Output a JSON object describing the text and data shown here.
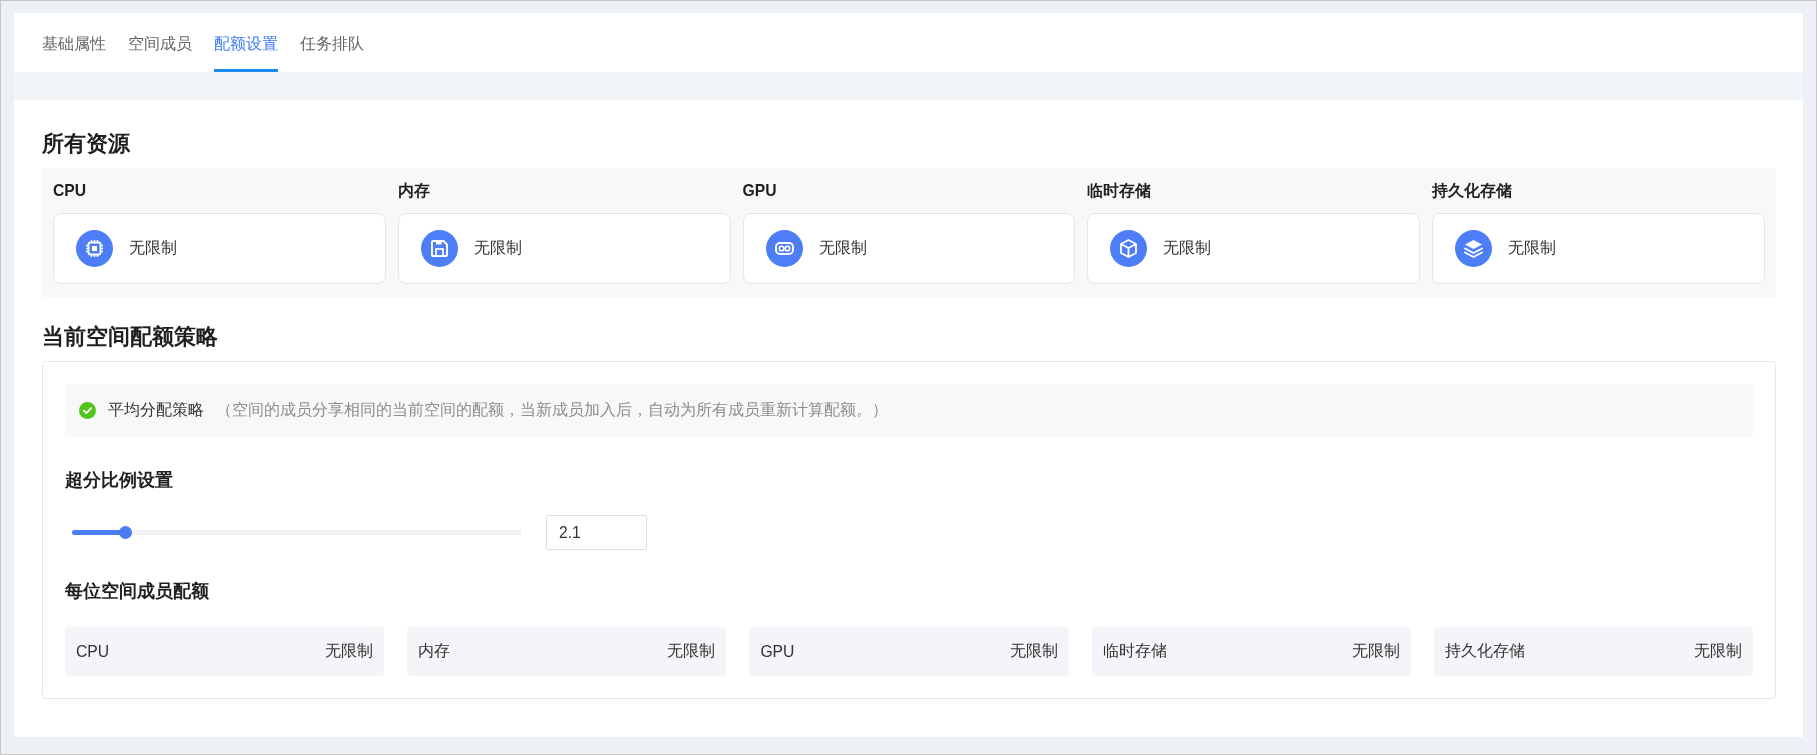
{
  "tabs": [
    {
      "label": "基础属性",
      "selected": false
    },
    {
      "label": "空间成员",
      "selected": false
    },
    {
      "label": "配额设置",
      "selected": true
    },
    {
      "label": "任务排队",
      "selected": false
    }
  ],
  "all_resources": {
    "title": "所有资源",
    "items": [
      {
        "label": "CPU",
        "value": "无限制"
      },
      {
        "label": "内存",
        "value": "无限制"
      },
      {
        "label": "GPU",
        "value": "无限制"
      },
      {
        "label": "临时存储",
        "value": "无限制"
      },
      {
        "label": "持久化存储",
        "value": "无限制"
      }
    ]
  },
  "quota_strategy": {
    "title": "当前空间配额策略",
    "policy": {
      "name": "平均分配策略",
      "description": "（空间的成员分享相同的当前空间的配额，当新成员加入后，自动为所有成员重新计算配额。）",
      "checked": true
    },
    "overcommit": {
      "title": "超分比例设置",
      "level": 0.12,
      "value": "2.1"
    },
    "member_quota": {
      "title": "每位空间成员配额",
      "items": [
        {
          "label": "CPU",
          "value": "无限制"
        },
        {
          "label": "内存",
          "value": "无限制"
        },
        {
          "label": "GPU",
          "value": "无限制"
        },
        {
          "label": "临时存储",
          "value": "无限制"
        },
        {
          "label": "持久化存储",
          "value": "无限制"
        }
      ]
    }
  }
}
